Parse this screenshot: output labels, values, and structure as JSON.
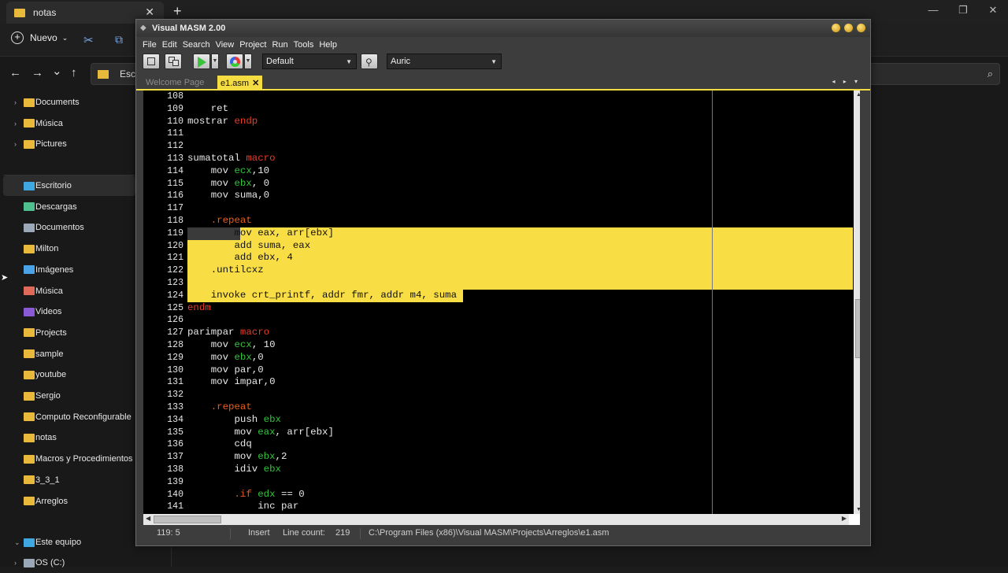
{
  "explorer": {
    "tab_title": "notas",
    "tab_close": "✕",
    "new_tab": "+",
    "window_controls": [
      "—",
      "❐",
      "✕"
    ],
    "cmd": {
      "nuevo_label": "Nuevo",
      "nuevo_plus": "+",
      "nuevo_chevron": "⌄",
      "cut_icon": "✂",
      "copy_icon": "⧉"
    },
    "nav": {
      "back": "←",
      "forward": "→",
      "recent": "⌄",
      "up": "↑",
      "address": "Escri",
      "search_icon": "⌕"
    },
    "sidebar": {
      "top_items": [
        {
          "label": "Documents",
          "icon": "folder",
          "color": "#e8b93a"
        },
        {
          "label": "Música",
          "icon": "folder",
          "color": "#e8b93a"
        },
        {
          "label": "Pictures",
          "icon": "folder",
          "color": "#e8b93a"
        }
      ],
      "items": [
        {
          "label": "Escritorio",
          "icon": "desktop",
          "color": "#3fa8e0"
        },
        {
          "label": "Descargas",
          "icon": "download",
          "color": "#4fbf8f"
        },
        {
          "label": "Documentos",
          "icon": "document",
          "color": "#9aa8b8"
        },
        {
          "label": "Milton",
          "icon": "folder",
          "color": "#e8b93a"
        },
        {
          "label": "Imágenes",
          "icon": "image",
          "color": "#4aa3e6"
        },
        {
          "label": "Música",
          "icon": "music",
          "color": "#e06a5a"
        },
        {
          "label": "Videos",
          "icon": "video",
          "color": "#8a5ad6"
        },
        {
          "label": "Projects",
          "icon": "folder",
          "color": "#e8b93a"
        },
        {
          "label": "sample",
          "icon": "folder",
          "color": "#e8b93a"
        },
        {
          "label": "youtube",
          "icon": "folder",
          "color": "#e8b93a"
        },
        {
          "label": "Sergio",
          "icon": "folder",
          "color": "#e8b93a"
        },
        {
          "label": "Computo Reconfigurable",
          "icon": "folder",
          "color": "#e8b93a"
        },
        {
          "label": "notas",
          "icon": "folder",
          "color": "#e8b93a"
        },
        {
          "label": "Macros y Procedimientos",
          "icon": "folder",
          "color": "#e8b93a"
        },
        {
          "label": "3_3_1",
          "icon": "folder",
          "color": "#e8b93a"
        },
        {
          "label": "Arreglos",
          "icon": "folder",
          "color": "#e8b93a"
        }
      ],
      "this_pc": "Este equipo",
      "drive": "OS (C:)",
      "chevron_right": "›",
      "chevron_down": "⌄"
    },
    "cursor": "➤"
  },
  "vm": {
    "title": "Visual MASM 2.00",
    "title_icon": "◆",
    "menu": [
      "File",
      "Edit",
      "Search",
      "View",
      "Project",
      "Run",
      "Tools",
      "Help"
    ],
    "toolbar": {
      "config": "Default",
      "theme": "Auric",
      "drop_arrow": "▼",
      "pin_icon": "⚲"
    },
    "tabs": {
      "welcome": "Welcome Page",
      "active": "e1.asm",
      "close": "✕",
      "nav_arrows": "◂ ▸ ▾"
    },
    "accent_color": "#f5dc43",
    "editor": {
      "lines": [
        {
          "n": "108",
          "segs": []
        },
        {
          "n": "109",
          "segs": [
            [
              "    ret",
              ""
            ]
          ]
        },
        {
          "n": "110",
          "segs": [
            [
              "mostrar ",
              ""
            ],
            [
              "endp",
              "red"
            ]
          ]
        },
        {
          "n": "111",
          "segs": []
        },
        {
          "n": "112",
          "segs": []
        },
        {
          "n": "113",
          "segs": [
            [
              "sumatotal ",
              ""
            ],
            [
              "macro",
              "red"
            ]
          ]
        },
        {
          "n": "114",
          "segs": [
            [
              "    mov ",
              ""
            ],
            [
              "ecx",
              "green"
            ],
            [
              ",10",
              ""
            ]
          ]
        },
        {
          "n": "115",
          "segs": [
            [
              "    mov ",
              ""
            ],
            [
              "ebx",
              "green"
            ],
            [
              ", 0",
              ""
            ]
          ]
        },
        {
          "n": "116",
          "segs": [
            [
              "    mov suma,0",
              ""
            ]
          ]
        },
        {
          "n": "117",
          "segs": []
        },
        {
          "n": "118",
          "segs": [
            [
              "    ",
              ""
            ],
            [
              ".repeat",
              "orange"
            ]
          ]
        },
        {
          "n": "119",
          "segs": [
            [
              "        mov eax, arr[ebx]",
              ""
            ]
          ]
        },
        {
          "n": "120",
          "segs": [
            [
              "        add suma, eax",
              ""
            ]
          ]
        },
        {
          "n": "121",
          "segs": [
            [
              "        add ebx, 4",
              ""
            ]
          ]
        },
        {
          "n": "122",
          "segs": [
            [
              "    .untilcxz",
              ""
            ]
          ]
        },
        {
          "n": "123",
          "segs": []
        },
        {
          "n": "124",
          "segs": [
            [
              "    invoke crt_printf, addr fmr, addr m4, suma",
              ""
            ]
          ]
        },
        {
          "n": "125",
          "segs": [
            [
              "endm",
              "red"
            ]
          ]
        },
        {
          "n": "126",
          "segs": []
        },
        {
          "n": "127",
          "segs": [
            [
              "parimpar ",
              ""
            ],
            [
              "macro",
              "red"
            ]
          ]
        },
        {
          "n": "128",
          "segs": [
            [
              "    mov ",
              ""
            ],
            [
              "ecx",
              "green"
            ],
            [
              ", 10",
              ""
            ]
          ]
        },
        {
          "n": "129",
          "segs": [
            [
              "    mov ",
              ""
            ],
            [
              "ebx",
              "green"
            ],
            [
              ",0",
              ""
            ]
          ]
        },
        {
          "n": "130",
          "segs": [
            [
              "    mov par,0",
              ""
            ]
          ]
        },
        {
          "n": "131",
          "segs": [
            [
              "    mov impar,0",
              ""
            ]
          ]
        },
        {
          "n": "132",
          "segs": []
        },
        {
          "n": "133",
          "segs": [
            [
              "    ",
              ""
            ],
            [
              ".repeat",
              "orange"
            ]
          ]
        },
        {
          "n": "134",
          "segs": [
            [
              "        push ",
              ""
            ],
            [
              "ebx",
              "green"
            ]
          ]
        },
        {
          "n": "135",
          "segs": [
            [
              "        mov ",
              ""
            ],
            [
              "eax",
              "green"
            ],
            [
              ", arr[ebx]",
              ""
            ]
          ]
        },
        {
          "n": "136",
          "segs": [
            [
              "        cdq",
              ""
            ]
          ]
        },
        {
          "n": "137",
          "segs": [
            [
              "        mov ",
              ""
            ],
            [
              "ebx",
              "green"
            ],
            [
              ",2",
              ""
            ]
          ]
        },
        {
          "n": "138",
          "segs": [
            [
              "        idiv ",
              ""
            ],
            [
              "ebx",
              "green"
            ]
          ]
        },
        {
          "n": "139",
          "segs": []
        },
        {
          "n": "140",
          "segs": [
            [
              "        ",
              ""
            ],
            [
              ".if",
              "orange"
            ],
            [
              " ",
              ""
            ],
            [
              "edx",
              "green"
            ],
            [
              " == 0",
              ""
            ]
          ]
        },
        {
          "n": "141",
          "segs": [
            [
              "            inc par",
              ""
            ]
          ]
        }
      ]
    },
    "scroll": {
      "up": "▲",
      "down": "▼",
      "left": "◀",
      "right": "▶"
    },
    "status": {
      "position": "119: 5",
      "mode": "Insert",
      "line_count_label": "Line count:",
      "line_count": "219",
      "path": "C:\\Program Files (x86)\\Visual MASM\\Projects\\Arreglos\\e1.asm"
    }
  }
}
